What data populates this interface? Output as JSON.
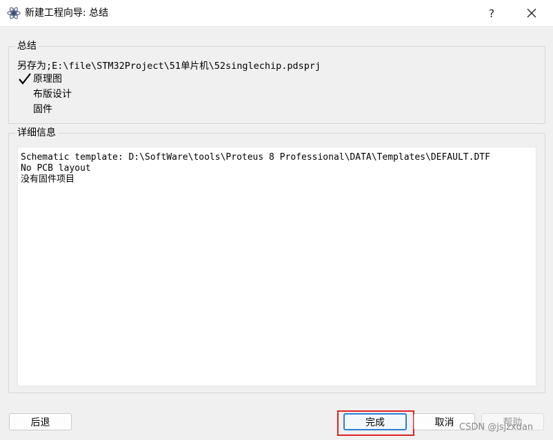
{
  "window": {
    "title": "新建工程向导: 总结",
    "help_glyph": "?",
    "close_glyph": "✕"
  },
  "summary": {
    "legend": "总结",
    "save_prefix": "另存为",
    "save_path": ";E:\\file\\STM32Project\\51单片机\\52singlechip.pdsprj",
    "options": [
      {
        "label": "原理图",
        "checked": true
      },
      {
        "label": "布版设计",
        "checked": false
      },
      {
        "label": "固件",
        "checked": false
      }
    ]
  },
  "details": {
    "legend": "详细信息",
    "lines": [
      "Schematic template: D:\\SoftWare\\tools\\Proteus 8 Professional\\DATA\\Templates\\DEFAULT.DTF",
      "No PCB layout",
      "没有固件项目"
    ]
  },
  "buttons": {
    "back": "后退",
    "finish": "完成",
    "cancel": "取消",
    "help": "帮助"
  },
  "watermark": "CSDN @jsjzxdan"
}
